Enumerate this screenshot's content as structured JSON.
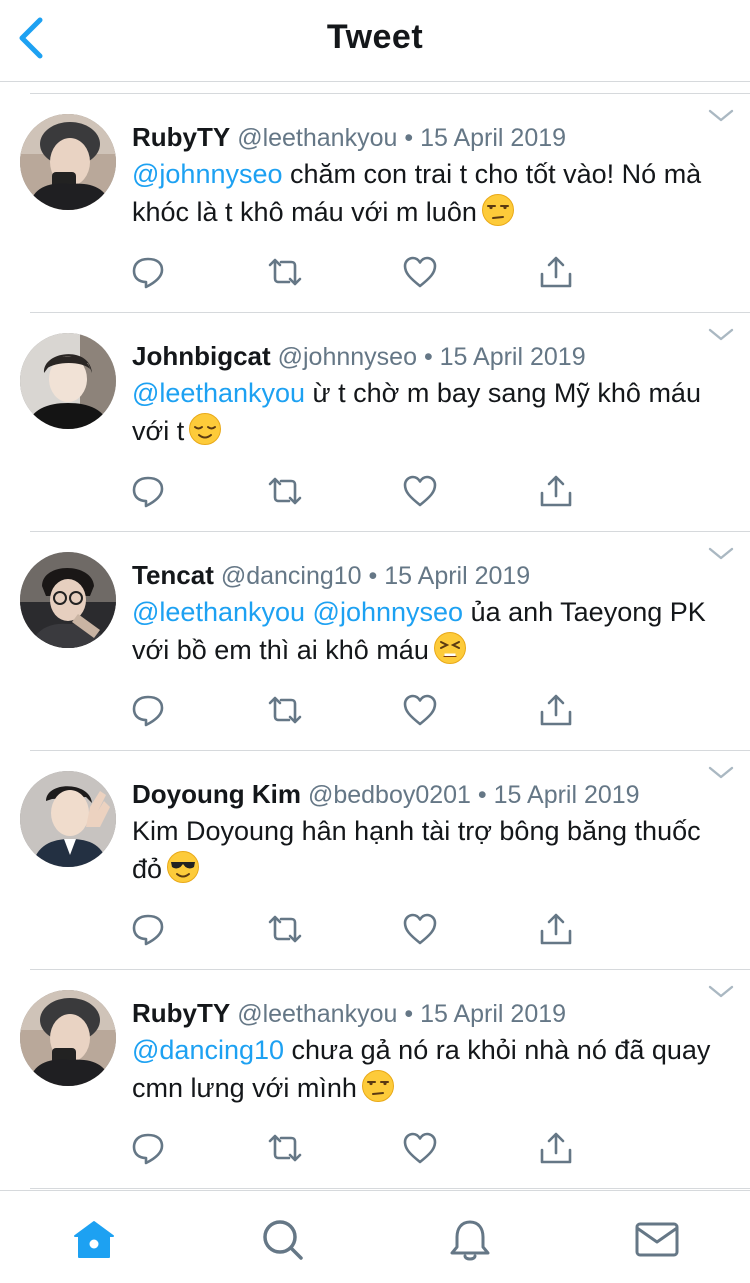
{
  "header": {
    "title": "Tweet",
    "back_icon": "chevron-left-icon"
  },
  "colors": {
    "accent": "#1da1f2",
    "text": "#14171a",
    "secondary": "#657786",
    "divider": "#d6d9dc",
    "icon": "#657786"
  },
  "tweets": [
    {
      "name": "RubyTY",
      "handle": "@leethankyou",
      "dot": "•",
      "date": "15 April 2019",
      "parts": [
        {
          "t": "@johnnyseo",
          "m": true
        },
        {
          "t": " chăm con trai t cho tốt vào! Nó mà khóc là t khô máu với m luôn",
          "m": false
        }
      ],
      "emoji": "unamused-face-emoji"
    },
    {
      "name": "Johnbigcat",
      "handle": "@johnnyseo",
      "dot": "•",
      "date": "15 April 2019",
      "parts": [
        {
          "t": "@leethankyou",
          "m": true
        },
        {
          "t": " ừ t chờ m bay sang Mỹ khô máu với t",
          "m": false
        }
      ],
      "emoji": "relieved-face-emoji"
    },
    {
      "name": "Tencat",
      "handle": "@dancing10",
      "dot": "•",
      "date": "15 April 2019",
      "parts": [
        {
          "t": "@leethankyou",
          "m": true
        },
        {
          "t": " ",
          "m": false
        },
        {
          "t": "@johnnyseo",
          "m": true
        },
        {
          "t": " ủa anh Taeyong PK với bồ em thì ai khô máu",
          "m": false
        }
      ],
      "emoji": "tired-face-emoji"
    },
    {
      "name": "Doyoung Kim",
      "handle": "@bedboy0201",
      "dot": "•",
      "date": "15 April 2019",
      "parts": [
        {
          "t": "Kim Doyoung hân hạnh tài trợ bông băng thuốc đỏ",
          "m": false
        }
      ],
      "emoji": "sunglasses-face-emoji"
    },
    {
      "name": "RubyTY",
      "handle": "@leethankyou",
      "dot": "•",
      "date": "15 April 2019",
      "parts": [
        {
          "t": "@dancing10",
          "m": true
        },
        {
          "t": " chưa gả nó ra khỏi nhà nó đã quay cmn lưng với mình",
          "m": false
        }
      ],
      "emoji": "unamused-face-emoji"
    }
  ],
  "actions": [
    "reply-icon",
    "retweet-icon",
    "like-icon",
    "share-icon"
  ],
  "tabbar": [
    "home-icon",
    "search-icon",
    "notifications-icon",
    "messages-icon"
  ]
}
